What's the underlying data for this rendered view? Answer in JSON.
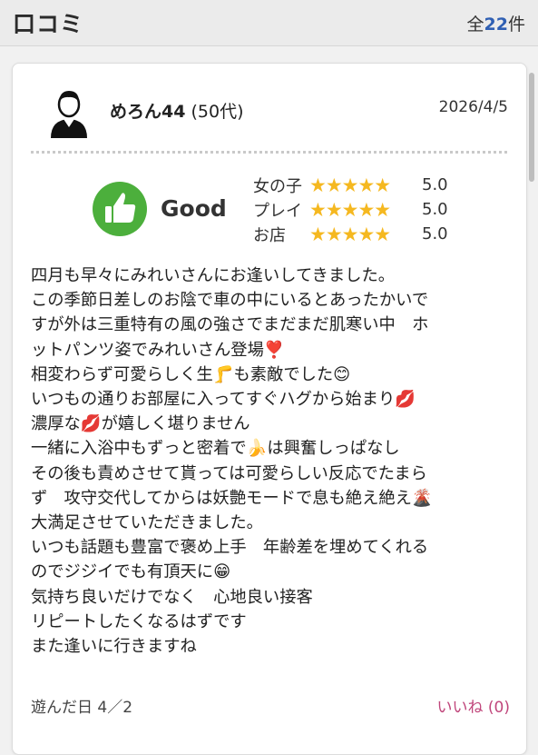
{
  "header": {
    "title": "口コミ",
    "count_prefix": "全",
    "count": "22",
    "count_suffix": "件"
  },
  "review": {
    "user_name": "めろん44",
    "user_age": "(50代)",
    "date": "2026/4/5",
    "verdict": "Good",
    "ratings": [
      {
        "label": "女の子",
        "stars": "★★★★★",
        "value": "5.0"
      },
      {
        "label": "プレイ",
        "stars": "★★★★★",
        "value": "5.0"
      },
      {
        "label": "お店",
        "stars": "★★★★★",
        "value": "5.0"
      }
    ],
    "body_lines": [
      "四月も早々にみれいさんにお逢いしてきました。",
      "この季節日差しのお陰で車の中にいるとあったかいで",
      "すが外は三重特有の風の強さでまだまだ肌寒い中　ホ",
      "ットパンツ姿でみれいさん登場❣️",
      "相変わらず可愛らしく生🦵も素敵でした😊",
      "いつもの通りお部屋に入ってすぐハグから始まり💋",
      "濃厚な💋が嬉しく堪りません",
      "一緒に入浴中もずっと密着で🍌は興奮しっぱなし",
      "その後も責めさせて貰っては可愛らしい反応でたまら",
      "ず　攻守交代してからは妖艶モードで息も絶え絶え🌋",
      "大満足させていただきました。",
      "いつも話題も豊富で褒め上手　年齢差を埋めてくれる",
      "のでジジイでも有頂天に😁",
      "気持ち良いだけでなく　心地良い接客",
      "リピートしたくなるはずです",
      "また逢いに行きますね"
    ],
    "played_date": "遊んだ日 4／2",
    "like_label": "いいね",
    "like_count": "(0)"
  },
  "colors": {
    "accent_blue": "#2f5fb3",
    "star": "#f5b820",
    "good_green": "#4caf3c",
    "like_pink": "#c0467b"
  },
  "icons": {
    "avatar": "user-avatar-icon",
    "verdict": "thumbs-up-icon",
    "star": "star-icon"
  }
}
